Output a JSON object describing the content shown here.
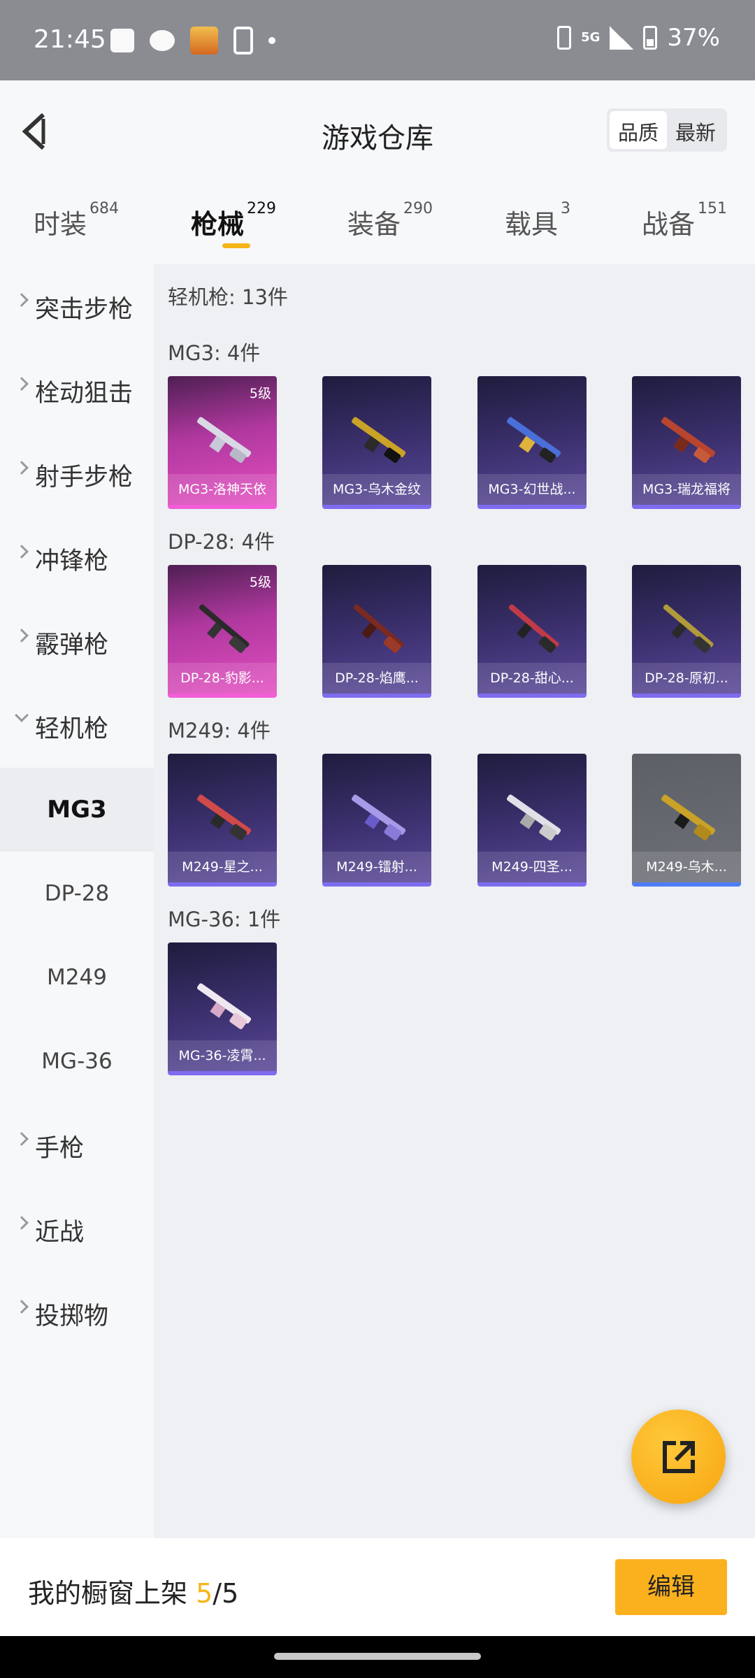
{
  "status_bar": {
    "time": "21:45",
    "network": "5G",
    "battery": "37%",
    "icons": [
      "message-icon",
      "wechat-icon",
      "game-app-icon",
      "phone-sync-icon",
      "dot-icon",
      "nfc-icon",
      "signal-icon",
      "battery-icon"
    ]
  },
  "header": {
    "title": "游戏仓库",
    "sort_options": [
      "品质",
      "最新"
    ],
    "sort_active": "品质"
  },
  "tabs": [
    {
      "label": "时装",
      "count": "684"
    },
    {
      "label": "枪械",
      "count": "229",
      "active": true
    },
    {
      "label": "装备",
      "count": "290"
    },
    {
      "label": "载具",
      "count": "3"
    },
    {
      "label": "战备",
      "count": "151"
    }
  ],
  "sidebar": {
    "categories": [
      {
        "label": "突击步枪"
      },
      {
        "label": "栓动狙击"
      },
      {
        "label": "射手步枪"
      },
      {
        "label": "冲锋枪"
      },
      {
        "label": "霰弹枪"
      },
      {
        "label": "轻机枪",
        "expanded": true
      }
    ],
    "subcategories": [
      {
        "label": "MG3",
        "active": true
      },
      {
        "label": "DP-28"
      },
      {
        "label": "M249"
      },
      {
        "label": "MG-36"
      }
    ],
    "more_categories": [
      {
        "label": "手枪"
      },
      {
        "label": "近战"
      },
      {
        "label": "投掷物"
      }
    ]
  },
  "content": {
    "total": "轻机枪: 13件",
    "groups": [
      {
        "title": "MG3: 4件",
        "items": [
          {
            "name": "MG3-洛神天依",
            "level": "5级",
            "tier": "pink"
          },
          {
            "name": "MG3-乌木金纹",
            "tier": "purple"
          },
          {
            "name": "MG3-幻世战...",
            "tier": "purple"
          },
          {
            "name": "MG3-瑞龙福将",
            "tier": "purple"
          }
        ]
      },
      {
        "title": "DP-28: 4件",
        "items": [
          {
            "name": "DP-28-豹影...",
            "level": "5级",
            "tier": "pink"
          },
          {
            "name": "DP-28-焰鹰...",
            "tier": "purple"
          },
          {
            "name": "DP-28-甜心...",
            "tier": "purple"
          },
          {
            "name": "DP-28-原初...",
            "tier": "purple"
          }
        ]
      },
      {
        "title": "M249: 4件",
        "items": [
          {
            "name": "M249-星之...",
            "tier": "purple"
          },
          {
            "name": "M249-镭射...",
            "tier": "purple"
          },
          {
            "name": "M249-四圣...",
            "tier": "purple"
          },
          {
            "name": "M249-乌木...",
            "tier": "gray"
          }
        ]
      },
      {
        "title": "MG-36: 1件",
        "items": [
          {
            "name": "MG-36-凌霄...",
            "tier": "purple"
          }
        ]
      }
    ]
  },
  "bottom_bar": {
    "shelf_label": "我的橱窗上架",
    "shelf_used": "5",
    "shelf_total": "/5",
    "edit_label": "编辑"
  },
  "colors": {
    "accent": "#f7b519",
    "pink_tier": "#e34fc0",
    "purple_tier": "#7e6cf0",
    "blue_tier": "#4e7df5"
  }
}
